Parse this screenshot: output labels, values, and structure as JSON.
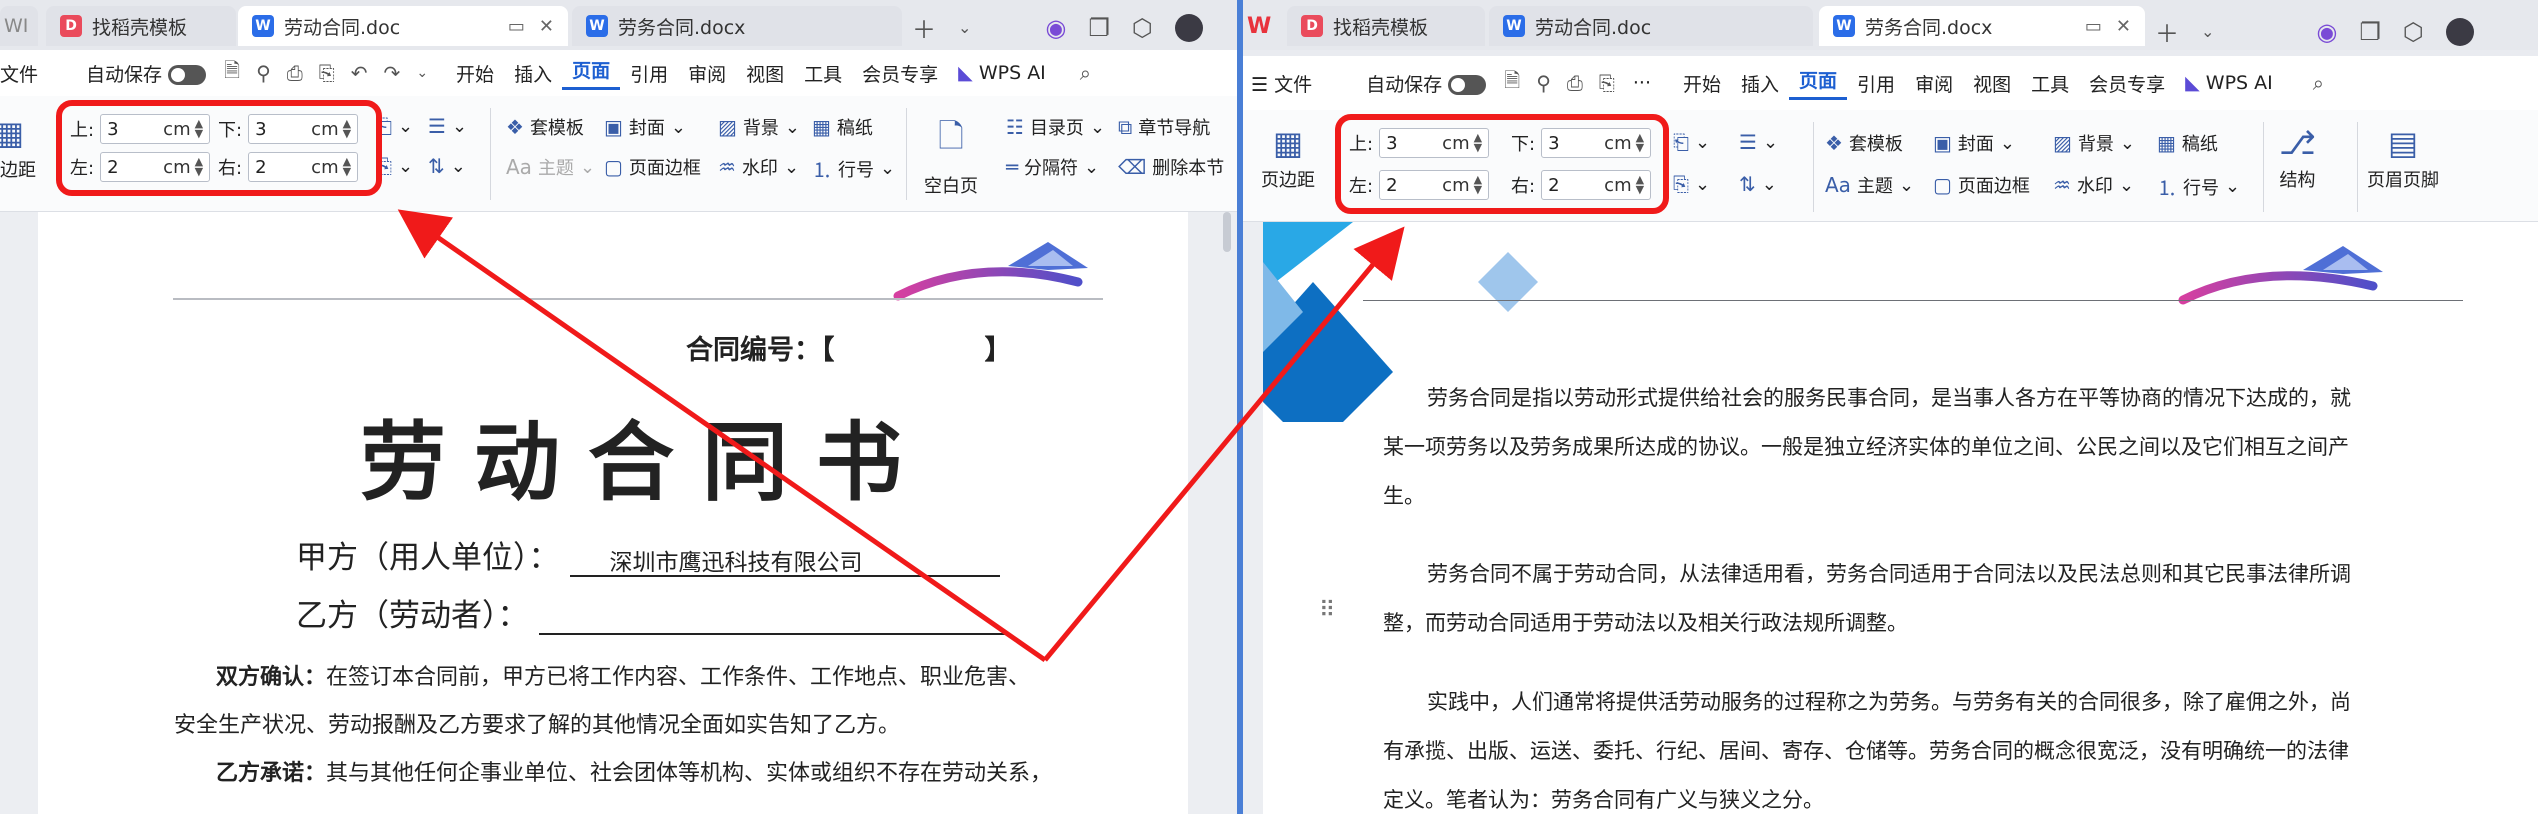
{
  "left": {
    "tabs": [
      {
        "label": "WI",
        "icon": "wps-home-icon"
      },
      {
        "label": "找稻壳模板",
        "icon": "docer-icon"
      },
      {
        "label": "劳动合同.doc",
        "icon": "word-doc-icon"
      },
      {
        "label": "劳务合同.docx",
        "icon": "word-doc-icon"
      }
    ],
    "menu": {
      "file": "文件",
      "autosave": "自动保存",
      "items": [
        "开始",
        "插入",
        "页面",
        "引用",
        "审阅",
        "视图",
        "工具",
        "会员专享"
      ],
      "active": "页面",
      "wps_ai": "WPS AI"
    },
    "ribbon": {
      "margins_btn": "页边距",
      "top_label": "上:",
      "top_value": "3",
      "top_unit": "cm",
      "bottom_label": "下:",
      "bottom_value": "3",
      "bottom_unit": "cm",
      "left_label": "左:",
      "left_value": "2",
      "left_unit": "cm",
      "right_label": "右:",
      "right_value": "2",
      "right_unit": "cm",
      "theme_template": "套模板",
      "theme": "主题",
      "cover": "封面",
      "page_border": "页面边框",
      "background": "背景",
      "watermark": "水印",
      "manuscript": "稿纸",
      "line_number": "行号",
      "blank_page": "空白页",
      "toc_page": "目录页",
      "separator": "分隔符",
      "chapter_nav": "章节导航",
      "delete_section": "删除本节"
    },
    "doc": {
      "contract_no": "合同编号：【",
      "contract_no_end": "】",
      "title": "劳动合同书",
      "party_a_label": "甲方（用人单位）：",
      "party_a_value": "深圳市鹰迅科技有限公司",
      "party_b_label": "乙方（劳动者）：",
      "confirm_label": "双方确认：",
      "confirm_text_1": "在签订本合同前，甲方已将工作内容、工作条件、工作地点、职业危害、",
      "confirm_text_2": "安全生产状况、劳动报酬及乙方要求了解的其他情况全面如实告知了乙方。",
      "promise_label": "乙方承诺：",
      "promise_text": "其与其他任何企事业单位、社会团体等机构、实体或组织不存在劳动关系，"
    }
  },
  "right": {
    "tabs": [
      {
        "label": "找稻壳模板",
        "icon": "docer-icon"
      },
      {
        "label": "劳动合同.doc",
        "icon": "word-doc-icon"
      },
      {
        "label": "劳务合同.docx",
        "icon": "word-doc-icon"
      }
    ],
    "menu": {
      "file": "文件",
      "autosave": "自动保存",
      "items": [
        "开始",
        "插入",
        "页面",
        "引用",
        "审阅",
        "视图",
        "工具",
        "会员专享"
      ],
      "active": "页面",
      "more": "···",
      "wps_ai": "WPS AI"
    },
    "ribbon": {
      "margins_btn": "页边距",
      "top_label": "上:",
      "top_value": "3",
      "top_unit": "cm",
      "bottom_label": "下:",
      "bottom_value": "3",
      "bottom_unit": "cm",
      "left_label": "左:",
      "left_value": "2",
      "left_unit": "cm",
      "right_label": "右:",
      "right_value": "2",
      "right_unit": "cm",
      "theme_template": "套模板",
      "theme": "主题",
      "cover": "封面",
      "page_border": "页面边框",
      "background": "背景",
      "watermark": "水印",
      "manuscript": "稿纸",
      "line_number": "行号",
      "structure": "结构",
      "header_footer": "页眉页脚"
    },
    "doc": {
      "p1_l1": "劳务合同是指以劳动形式提供给社会的服务民事合同，是当事人各方在平等协商的情况下达成的，就",
      "p1_l2": "某一项劳务以及劳务成果所达成的协议。一般是独立经济实体的单位之间、公民之间以及它们相互之间产",
      "p1_l3": "生。",
      "p2_l1": "劳务合同不属于劳动合同，从法律适用看，劳务合同适用于合同法以及民法总则和其它民事法律所调",
      "p2_l2": "整，而劳动合同适用于劳动法以及相关行政法规所调整。",
      "p3_l1": "实践中，人们通常将提供活劳动服务的过程称之为劳务。与劳务有关的合同很多，除了雇佣之外，尚",
      "p3_l2": "有承揽、出版、运送、委托、行纪、居间、寄存、仓储等。劳务合同的概念很宽泛，没有明确统一的法律",
      "p3_l3": "定义。笔者认为：劳务合同有广义与狭义之分。"
    }
  },
  "colors": {
    "highlight": "#f01a1a",
    "accent": "#1d5fd1"
  }
}
